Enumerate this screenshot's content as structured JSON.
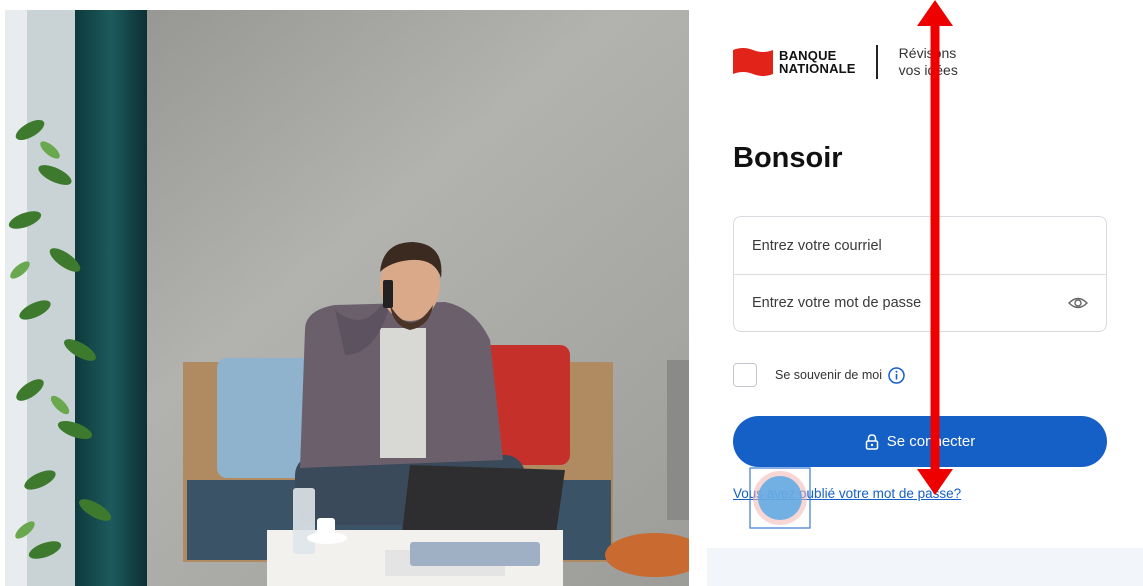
{
  "brand": {
    "name_line1": "BANQUE",
    "name_line2": "NATIONALE",
    "tagline_line1": "Révisons",
    "tagline_line2": "vos idées",
    "color": "#e2231a"
  },
  "greeting": "Bonsoir",
  "login": {
    "email_placeholder": "Entrez votre courriel",
    "email_value": "",
    "password_placeholder": "Entrez votre mot de passe",
    "password_value": "",
    "password_toggle_icon": "eye-icon",
    "remember_label": "Se souvenir de moi",
    "remember_checked": false,
    "info_icon": "info-icon",
    "submit_label": "Se connecter",
    "submit_icon": "lock-icon",
    "forgot_link": "Vous avez oublié votre mot de passe?"
  },
  "colors": {
    "primary": "#1560c7",
    "border": "#d8dbe0",
    "annotation_arrow": "#ee0000",
    "click_marker": "#5aa9e6"
  }
}
